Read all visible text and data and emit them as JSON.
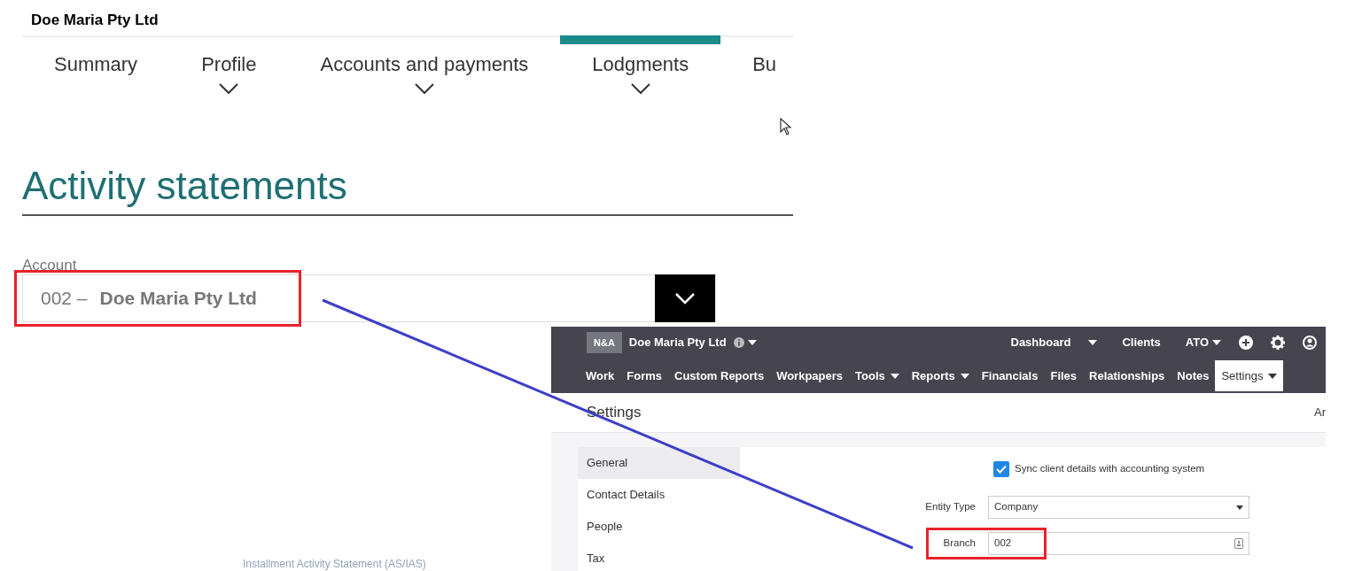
{
  "ato": {
    "entity": "Doe Maria Pty Ltd",
    "tabs": [
      {
        "label": "Summary",
        "has_menu": false,
        "selected": false
      },
      {
        "label": "Profile",
        "has_menu": true,
        "selected": false
      },
      {
        "label": "Accounts and payments",
        "has_menu": true,
        "selected": false
      },
      {
        "label": "Lodgments",
        "has_menu": true,
        "selected": true
      },
      {
        "label": "Bu",
        "has_menu": false,
        "selected": false
      }
    ],
    "heading": "Activity statements",
    "account_label": "Account",
    "account_number": "002 –",
    "account_name": "Doe Maria Pty Ltd"
  },
  "app": {
    "badge": "N&A",
    "client": "Doe Maria Pty Ltd",
    "top_links": [
      {
        "label": "Dashboard",
        "has_menu": true
      },
      {
        "label": "Clients",
        "has_menu": false
      },
      {
        "label": "ATO",
        "has_menu": true
      }
    ],
    "nav": [
      {
        "label": "Work",
        "has_menu": false,
        "selected": false
      },
      {
        "label": "Forms",
        "has_menu": false,
        "selected": false
      },
      {
        "label": "Custom Reports",
        "has_menu": false,
        "selected": false
      },
      {
        "label": "Workpapers",
        "has_menu": false,
        "selected": false
      },
      {
        "label": "Tools",
        "has_menu": true,
        "selected": false
      },
      {
        "label": "Reports",
        "has_menu": true,
        "selected": false
      },
      {
        "label": "Financials",
        "has_menu": false,
        "selected": false
      },
      {
        "label": "Files",
        "has_menu": false,
        "selected": false
      },
      {
        "label": "Relationships",
        "has_menu": false,
        "selected": false
      },
      {
        "label": "Notes",
        "has_menu": false,
        "selected": false
      },
      {
        "label": "Settings",
        "has_menu": true,
        "selected": true
      }
    ],
    "page_title": "Settings",
    "right_text": "Ar",
    "sidebar": [
      {
        "label": "General",
        "selected": true
      },
      {
        "label": "Contact Details",
        "selected": false
      },
      {
        "label": "People",
        "selected": false
      },
      {
        "label": "Tax",
        "selected": false
      }
    ],
    "sync": {
      "label": "Sync client details with accounting system",
      "checked": true
    },
    "entity_type": {
      "label": "Entity Type",
      "value": "Company"
    },
    "branch": {
      "label": "Branch",
      "value": "002"
    }
  },
  "footer_text": "Installment Activity Statement (AS/IAS)"
}
